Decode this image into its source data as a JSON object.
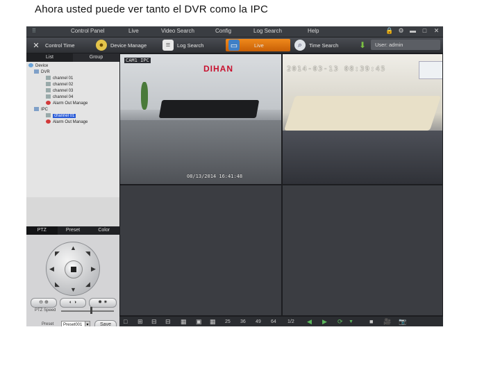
{
  "caption": "Ahora usted puede ver tanto el DVR como la IPC",
  "menu": [
    "Control Panel",
    "Live",
    "Video Search",
    "Config",
    "Log Search",
    "Help"
  ],
  "toolbar": {
    "control_time": "Control Time",
    "device_manage": "Device Manage",
    "log_search": "Log Search",
    "live": "Live",
    "time_search": "Time Search",
    "user": "User: admin"
  },
  "left_tabs": [
    "List",
    "Group"
  ],
  "tree": [
    {
      "label": "Device",
      "level": 0
    },
    {
      "label": "DVR",
      "level": 1
    },
    {
      "label": "channel 01",
      "level": 2
    },
    {
      "label": "channel 02",
      "level": 2
    },
    {
      "label": "channel 03",
      "level": 2
    },
    {
      "label": "channel 04",
      "level": 2
    },
    {
      "label": "Alarm Out Manage",
      "level": 2
    },
    {
      "label": "IPC",
      "level": 1
    },
    {
      "label": "channel 01",
      "level": 2,
      "selected": true
    },
    {
      "label": "Alarm Out Manage",
      "level": 2
    }
  ],
  "ptz_tabs": [
    "PTZ",
    "Preset",
    "Color"
  ],
  "ptz": {
    "ptz_speed_label": "PTZ Speed",
    "preset_label": "Preset",
    "preset_value": "Preset001",
    "save": "Save"
  },
  "footer_text": "• • • • • • •",
  "video": {
    "cam1_tag": "CAM1 IPC",
    "cam1_brand": "DIHAN",
    "cam1_timestamp": "08/13/2014  16:41:48",
    "cam2_timestamp": "2014-03-13 08:39:45"
  },
  "bottom": {
    "count_a": "25",
    "count_b": "36",
    "count_c": "49",
    "count_d": "64",
    "ratio": "1/2"
  },
  "colors": {
    "accent": "#e67812",
    "selection": "#2a5bd7"
  }
}
